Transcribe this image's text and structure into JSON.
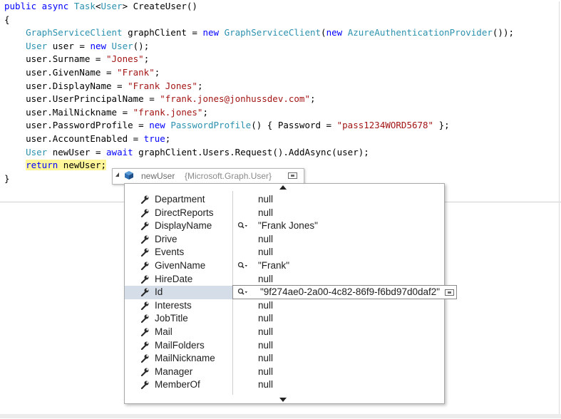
{
  "editor": {
    "lines": [
      [
        {
          "t": "public async ",
          "c": "kw"
        },
        {
          "t": "Task",
          "c": "ty"
        },
        {
          "t": "<"
        },
        {
          "t": "User",
          "c": "ty"
        },
        {
          "t": "> CreateUser()"
        }
      ],
      [
        {
          "t": "{"
        }
      ],
      [
        {
          "t": "    "
        },
        {
          "t": "GraphServiceClient",
          "c": "ty"
        },
        {
          "t": " graphClient = "
        },
        {
          "t": "new ",
          "c": "kw"
        },
        {
          "t": "GraphServiceClient",
          "c": "ty"
        },
        {
          "t": "("
        },
        {
          "t": "new ",
          "c": "kw"
        },
        {
          "t": "AzureAuthenticationProvider",
          "c": "ty"
        },
        {
          "t": "());"
        }
      ],
      [
        {
          "t": "    "
        },
        {
          "t": "User",
          "c": "ty"
        },
        {
          "t": " user = "
        },
        {
          "t": "new ",
          "c": "kw"
        },
        {
          "t": "User",
          "c": "ty"
        },
        {
          "t": "();"
        }
      ],
      [
        {
          "t": "    user.Surname = "
        },
        {
          "t": "\"Jones\"",
          "c": "st"
        },
        {
          "t": ";"
        }
      ],
      [
        {
          "t": "    user.GivenName = "
        },
        {
          "t": "\"Frank\"",
          "c": "st"
        },
        {
          "t": ";"
        }
      ],
      [
        {
          "t": "    user.DisplayName = "
        },
        {
          "t": "\"Frank Jones\"",
          "c": "st"
        },
        {
          "t": ";"
        }
      ],
      [
        {
          "t": "    user.UserPrincipalName = "
        },
        {
          "t": "\"frank.jones@jonhussdev.com\"",
          "c": "st"
        },
        {
          "t": ";"
        }
      ],
      [
        {
          "t": "    user.MailNickname = "
        },
        {
          "t": "\"frank.jones\"",
          "c": "st"
        },
        {
          "t": ";"
        }
      ],
      [
        {
          "t": "    user.PasswordProfile = "
        },
        {
          "t": "new ",
          "c": "kw"
        },
        {
          "t": "PasswordProfile",
          "c": "ty"
        },
        {
          "t": "() { Password = "
        },
        {
          "t": "\"pass1234WORD5678\"",
          "c": "st"
        },
        {
          "t": " };"
        }
      ],
      [
        {
          "t": "    user.AccountEnabled = "
        },
        {
          "t": "true",
          "c": "kw"
        },
        {
          "t": ";"
        }
      ],
      [
        {
          "t": "    "
        },
        {
          "t": "User",
          "c": "ty"
        },
        {
          "t": " newUser = "
        },
        {
          "t": "await ",
          "c": "kw"
        },
        {
          "t": "graphClient.Users.Request().AddAsync(user);"
        }
      ],
      [
        {
          "t": "    "
        },
        {
          "t": "return",
          "c": "kw hl"
        },
        {
          "t": " newUser;",
          "c": "hl"
        }
      ],
      [
        {
          "t": "}"
        }
      ]
    ]
  },
  "datatip": {
    "variable": "newUser",
    "type": "{Microsoft.Graph.User}",
    "rows": [
      {
        "name": "Department",
        "value": "null",
        "mag": false
      },
      {
        "name": "DirectReports",
        "value": "null",
        "mag": false
      },
      {
        "name": "DisplayName",
        "value": "\"Frank Jones\"",
        "mag": true
      },
      {
        "name": "Drive",
        "value": "null",
        "mag": false
      },
      {
        "name": "Events",
        "value": "null",
        "mag": false
      },
      {
        "name": "GivenName",
        "value": "\"Frank\"",
        "mag": true
      },
      {
        "name": "HireDate",
        "value": "null",
        "mag": false
      },
      {
        "name": "Id",
        "value": "\"9f274ae0-2a00-4c82-86f9-f6bd97d0daf2\"",
        "mag": true,
        "selected": true
      },
      {
        "name": "Interests",
        "value": "null",
        "mag": false
      },
      {
        "name": "JobTitle",
        "value": "null",
        "mag": false
      },
      {
        "name": "Mail",
        "value": "null",
        "mag": false
      },
      {
        "name": "MailFolders",
        "value": "null",
        "mag": false
      },
      {
        "name": "MailNickname",
        "value": "null",
        "mag": false
      },
      {
        "name": "Manager",
        "value": "null",
        "mag": false
      },
      {
        "name": "MemberOf",
        "value": "null",
        "mag": false
      }
    ]
  },
  "colors": {
    "keyword": "#0000ff",
    "type": "#2b91af",
    "string": "#a31515",
    "highlight": "#fff69a"
  }
}
